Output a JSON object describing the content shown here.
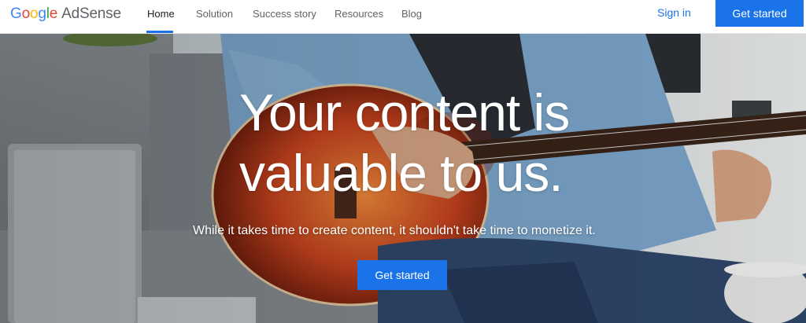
{
  "brand": {
    "logo_google": "Google",
    "logo_product": "AdSense",
    "colors": {
      "blue": "#4285F4",
      "red": "#EA4335",
      "yellow": "#FBBC05",
      "green": "#34A853",
      "accent": "#1a73e8"
    }
  },
  "nav": {
    "items": [
      {
        "label": "Home",
        "active": true
      },
      {
        "label": "Solution",
        "active": false
      },
      {
        "label": "Success story",
        "active": false
      },
      {
        "label": "Resources",
        "active": false
      },
      {
        "label": "Blog",
        "active": false
      }
    ],
    "sign_in": "Sign in",
    "cta": "Get started"
  },
  "hero": {
    "headline_line1": "Your content is",
    "headline_line2": "valuable to us.",
    "subtext": "While it takes time to create content, it shouldn't take time to monetize it.",
    "cta": "Get started",
    "image_subject": "person-playing-acoustic-guitar-on-sofa"
  }
}
